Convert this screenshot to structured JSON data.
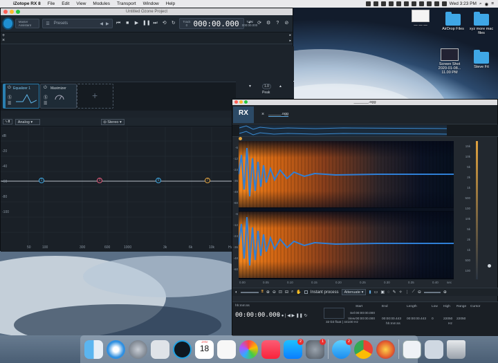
{
  "menubar": {
    "app": "iZotope RX 8",
    "items": [
      "File",
      "Edit",
      "View",
      "Modules",
      "Transport",
      "Window",
      "Help"
    ],
    "clock": "Wed 3:23 PM"
  },
  "desktop": {
    "icons": [
      {
        "label": "— — —",
        "kind": "thumb"
      },
      {
        "label": "AirDrop Files",
        "kind": "folder"
      },
      {
        "label": "xyz more mac files",
        "kind": "folder"
      },
      {
        "label": "Screen Shot 2020-01-08... 11.00 PM",
        "kind": "thumb"
      },
      {
        "label": "Steve Fit",
        "kind": "folder"
      }
    ]
  },
  "izotope": {
    "title": "Untitled Ozone Project",
    "toolbar": {
      "preset_placeholder": "Master Assistant",
      "presets": "Presets",
      "track_label": "Track",
      "track_num": "0",
      "time": "000:00.000",
      "total_label": "Total",
      "total_time": "000:00.000"
    },
    "modules": [
      {
        "name": "Equalizer 1"
      },
      {
        "name": "Maximizer"
      }
    ],
    "eq": {
      "mode": "Analog",
      "stereo": "Stereo",
      "db_labels": [
        "dB",
        "-20",
        "-40",
        "-60",
        "-80",
        "-100"
      ],
      "freq_labels": [
        "50",
        "100",
        "300",
        "600",
        "1000",
        "3k",
        "6k",
        "10k",
        "Hz"
      ],
      "nodes": [
        "1",
        "3",
        "5",
        "7"
      ]
    },
    "right_panel": {
      "peak": "Peak",
      "value": "1.0"
    }
  },
  "rx": {
    "title": "_______.ogg",
    "logo": "RX",
    "tab": "______.ogg",
    "left_db": [
      "-6",
      "-12",
      "-24",
      "-36",
      "-48",
      "-60",
      "-6",
      "-12",
      "-24",
      "-36",
      "-48",
      "-60"
    ],
    "right_hz": [
      "15k",
      "10k",
      "5k",
      "2k",
      "1k",
      "500",
      "100",
      "10k",
      "5k",
      "2k",
      "1k",
      "500",
      "100"
    ],
    "time_ticks": [
      "0.00",
      "0.05",
      "0.10",
      "0.15",
      "0.20",
      "0.25",
      "0.30",
      "0.35",
      "0.40",
      "sec"
    ],
    "tools": {
      "instant_process": "Instant process",
      "mode": "Attenuate"
    },
    "bottom": {
      "timecode": "00:00:00.000",
      "format_label": "hh:mm:ss",
      "start": "Start",
      "end": "End",
      "length": "Length",
      "low": "Low",
      "high": "High",
      "range": "Range",
      "cursor": "Cursor",
      "sel_label": "Sel",
      "view_label": "View",
      "sel_start": "00:00:00.000",
      "view_start": "00:00:00.000",
      "view_end": "00:00:00.443",
      "view_length": "00:00:00.443",
      "low_val": "0",
      "high_val": "22050",
      "range_val": "22050",
      "hz_unit": "Hz",
      "bit_info": "32-bit float | 44100 Hz",
      "left_time": "hh:mm:ss"
    }
  },
  "dock": {
    "apps": [
      "finder-icon",
      "safari-icon",
      "launchpad-icon",
      "migration-icon",
      "izotope-icon",
      "calendar-icon",
      "reminders-icon",
      "photos-icon",
      "music-icon",
      "app-store-icon",
      "system-prefs-icon",
      "messages-icon",
      "chrome-icon",
      "firefox-icon",
      "preview-icon",
      "downloads-icon",
      "trash-icon"
    ],
    "calendar_day": "18",
    "calendar_month": "JAN",
    "appstore_badge": "2",
    "sysprefs_badge": "1",
    "messages_badge": "2"
  }
}
